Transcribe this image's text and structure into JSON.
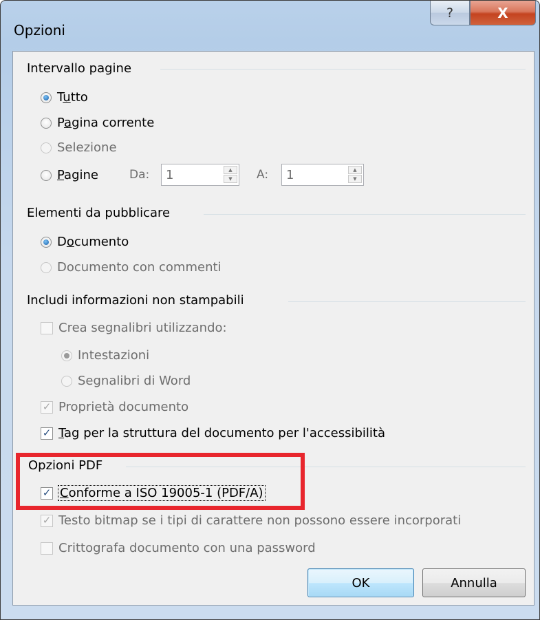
{
  "window": {
    "title": "Opzioni",
    "help_glyph": "?",
    "close_glyph": "X"
  },
  "page_range": {
    "title": "Intervallo pagine",
    "all": {
      "pre": "T",
      "acc": "u",
      "post": "tto"
    },
    "current": {
      "pre": "P",
      "acc": "a",
      "post": "gina corrente"
    },
    "selection": "Selezione",
    "pages": {
      "pre": "",
      "acc": "P",
      "post": "agine"
    },
    "from_label": "Da:",
    "from_value": "1",
    "to_label": "A:",
    "to_value": "1"
  },
  "publish": {
    "title": "Elementi da pubblicare",
    "document": {
      "pre": "D",
      "acc": "o",
      "post": "cumento"
    },
    "document_comments": "Documento con commenti"
  },
  "nonprint": {
    "title": "Includi informazioni non stampabili",
    "create_bookmarks": "Crea segnalibri utilizzando:",
    "headings": "Intestazioni",
    "word_bookmarks": "Segnalibri di Word",
    "doc_properties": "Proprietà documento",
    "structure_tags": {
      "pre": "",
      "acc": "T",
      "post": "ag per la struttura del documento per l'accessibilità"
    }
  },
  "pdf": {
    "title": "Opzioni PDF",
    "iso": {
      "pre": "",
      "acc": "C",
      "post": "onforme a ISO 19005-1 (PDF/A)"
    },
    "bitmap_text": "Testo bitmap se i tipi di carattere non possono essere incorporati",
    "encrypt": "Crittografa documento con una password"
  },
  "buttons": {
    "ok": "OK",
    "cancel": "Annulla"
  },
  "check_glyph": "✓",
  "colors": {
    "highlight": "#e8262d",
    "title_bar": "#b9d1ea",
    "close_button": "#c44320"
  }
}
